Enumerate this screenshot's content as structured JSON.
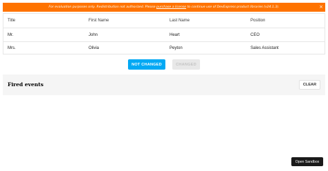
{
  "banner": {
    "text_before": "For evaluation purposes only. Redistribution not authorized. Please ",
    "link_text": "purchase a license",
    "text_after": " to continue use of DevExpress product libraries (v24.1.3).",
    "close_label": "×"
  },
  "grid": {
    "columns": [
      "Title",
      "First Name",
      "Last Name",
      "Position"
    ],
    "rows": [
      [
        "Mr.",
        "John",
        "Heart",
        "CEO"
      ],
      [
        "Mrs.",
        "Olivia",
        "Peyton",
        "Sales Assistant"
      ]
    ]
  },
  "buttons": {
    "not_changed": "NOT CHANGED",
    "changed": "CHANGED"
  },
  "events": {
    "title": "Fired events",
    "clear_label": "CLEAR"
  },
  "sandbox": {
    "label": "Open Sandbox"
  },
  "colors": {
    "banner_bg": "#ff7300",
    "primary_button": "#03a9f4",
    "disabled_button": "#e8e8e8"
  }
}
